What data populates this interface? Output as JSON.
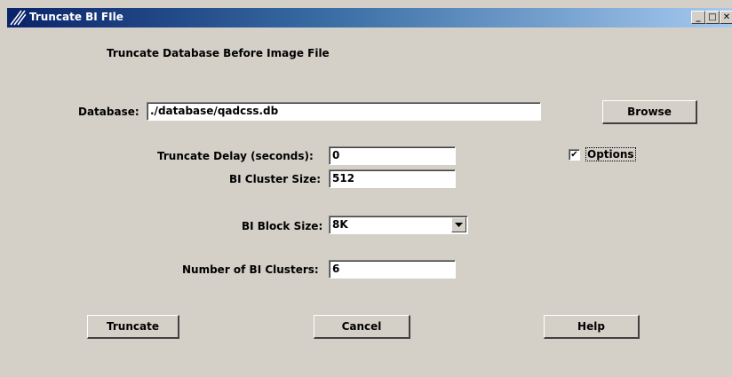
{
  "window": {
    "title": "Truncate BI FIle",
    "min_glyph": "_",
    "max_glyph": "□",
    "close_glyph": "✕"
  },
  "heading": "Truncate Database Before Image File",
  "database": {
    "label": "Database:",
    "value": "./database/qadcss.db",
    "browse_label": "Browse"
  },
  "truncate_delay": {
    "label": "Truncate Delay (seconds):",
    "value": "0"
  },
  "bi_cluster_size": {
    "label": "BI Cluster Size:",
    "value": "512"
  },
  "options": {
    "label": "Options",
    "checked": true,
    "check_glyph": "✔"
  },
  "bi_block_size": {
    "label": "BI Block Size:",
    "value": "8K"
  },
  "number_bi_clusters": {
    "label": "Number of BI Clusters:",
    "value": "6"
  },
  "buttons": {
    "truncate": "Truncate",
    "cancel": "Cancel",
    "help": "Help"
  }
}
